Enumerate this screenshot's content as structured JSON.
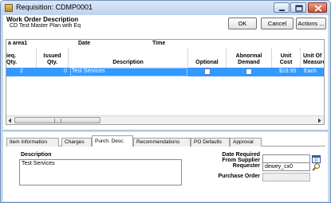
{
  "window": {
    "title": "Requisition: CDMP0001",
    "controls": {
      "minimize_icon": "minimize-icon",
      "maximize_icon": "maximize-icon",
      "close_icon": "close-icon"
    }
  },
  "header": {
    "title": "Work Order Description",
    "subtitle": "CD Test Master Plan with Eq",
    "buttons": {
      "ok": "OK",
      "cancel": "Cancel",
      "actions": "Actions ..."
    }
  },
  "grid": {
    "group_headers": {
      "area": "a area1",
      "date": "Date",
      "time": "Time"
    },
    "columns": {
      "req_qty": [
        "ieq.",
        "Qty."
      ],
      "issued_qty": [
        "Issued",
        "Qty."
      ],
      "description": "Description",
      "optional": "Optional",
      "abnormal_demand": [
        "Abnormal",
        "Demand"
      ],
      "unit_cost": [
        "Unit",
        "Cost"
      ],
      "unit_of_measure": [
        "Unit Of",
        "Measure"
      ]
    },
    "rows": [
      {
        "req_qty": "2",
        "issued_qty": "0",
        "description": "Test Services",
        "optional": false,
        "abnormal_demand": false,
        "unit_cost": "$19.95",
        "unit_of_measure": "Each"
      }
    ],
    "scrollbar": {
      "left_icon": "scroll-left-icon",
      "right_icon": "scroll-right-icon"
    }
  },
  "tabs": [
    {
      "label": "Item Information",
      "active": false
    },
    {
      "label": "Charges",
      "active": false
    },
    {
      "label": "Purch. Desc.",
      "active": true
    },
    {
      "label": "Recommendations",
      "active": false
    },
    {
      "label": "PO Defaults",
      "active": false
    },
    {
      "label": "Approval",
      "active": false
    }
  ],
  "purch_desc": {
    "description_label": "Description",
    "description_value": "Test Services",
    "date_required_label": [
      "Date Required",
      "From Supplier"
    ],
    "date_required_value": "",
    "requester_label": "Requester",
    "requester_value": "dewey_cx0",
    "purchase_order_label": "Purchase Order",
    "purchase_order_value": "",
    "calendar_icon": "calendar-icon",
    "lookup_icon": "search-icon"
  }
}
